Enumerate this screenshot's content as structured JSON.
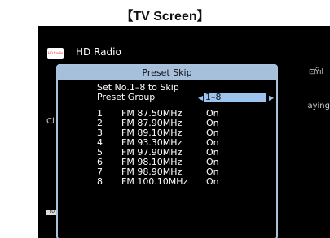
{
  "page_title": "【TV Screen】",
  "app": {
    "title": "HD Radio",
    "logo_text": "HD Radio"
  },
  "background": {
    "left_fragment": "Cl",
    "right_fragment": "aying",
    "badge": "TU",
    "signal": "⊡Ÿıl"
  },
  "dialog": {
    "title": "Preset Skip",
    "instruction": "Set No.1–8 to Skip",
    "group_label": "Preset Group",
    "group_value": "1–8",
    "presets": [
      {
        "number": "1",
        "frequency": "FM 87.50MHz",
        "status": "On"
      },
      {
        "number": "2",
        "frequency": "FM 87.90MHz",
        "status": "On"
      },
      {
        "number": "3",
        "frequency": "FM 89.10MHz",
        "status": "On"
      },
      {
        "number": "4",
        "frequency": "FM 93.30MHz",
        "status": "On"
      },
      {
        "number": "5",
        "frequency": "FM 97.90MHz",
        "status": "On"
      },
      {
        "number": "6",
        "frequency": "FM 98.10MHz",
        "status": "On"
      },
      {
        "number": "7",
        "frequency": "FM 98.90MHz",
        "status": "On"
      },
      {
        "number": "8",
        "frequency": "FM 100.10MHz",
        "status": "On"
      }
    ]
  },
  "colors": {
    "dialog_header": "#a6c0dc",
    "selection": "#9cc3ee",
    "screen": "#000000"
  }
}
